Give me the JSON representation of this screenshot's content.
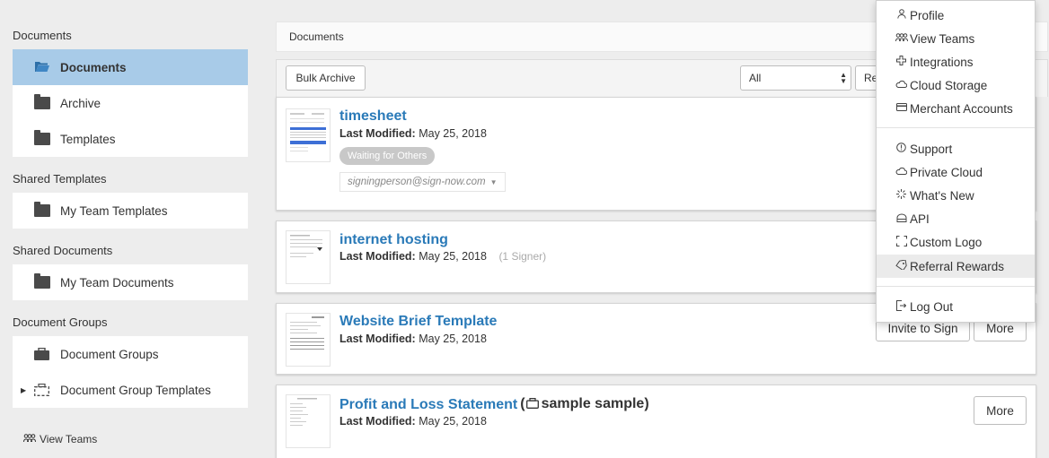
{
  "sidebar": {
    "documents_title": "Documents",
    "documents_items": [
      {
        "label": "Documents",
        "icon": "folder-open-icon",
        "active": true
      },
      {
        "label": "Archive",
        "icon": "folder-icon"
      },
      {
        "label": "Templates",
        "icon": "folder-icon"
      }
    ],
    "shared_templates_title": "Shared Templates",
    "shared_templates_items": [
      {
        "label": "My Team Templates",
        "icon": "folder-icon"
      }
    ],
    "shared_documents_title": "Shared Documents",
    "shared_documents_items": [
      {
        "label": "My Team Documents",
        "icon": "folder-icon"
      }
    ],
    "document_groups_title": "Document Groups",
    "document_groups_items": [
      {
        "label": "Document Groups",
        "icon": "briefcase-icon"
      },
      {
        "label": "Document Group Templates",
        "icon": "dashed-briefcase-icon"
      }
    ],
    "view_teams": "View Teams"
  },
  "breadcrumb": "Documents",
  "toolbar": {
    "bulk_archive": "Bulk Archive",
    "filter_selected": "All",
    "sort_partial": "Re"
  },
  "documents": [
    {
      "title": "timesheet",
      "modified_label": "Last Modified:",
      "modified_value": "May 25, 2018",
      "status": "Waiting for Others",
      "email": "signingperson@sign-now.com"
    },
    {
      "title": "internet hosting",
      "modified_label": "Last Modified:",
      "modified_value": "May 25, 2018",
      "signer_count": "(1 Signer)"
    },
    {
      "title": "Website Brief Template",
      "modified_label": "Last Modified:",
      "modified_value": "May 25, 2018",
      "invite_label": "Invite to Sign",
      "more_label": "More"
    },
    {
      "title": "Profit and Loss Statement",
      "folder_label": "sample sample",
      "modified_label": "Last Modified:",
      "modified_value": "May 25, 2018",
      "more_label": "More"
    }
  ],
  "menu": {
    "items": [
      {
        "label": "Profile",
        "icon": "user-icon"
      },
      {
        "label": "View Teams",
        "icon": "team-icon"
      },
      {
        "label": "Integrations",
        "icon": "puzzle-icon"
      },
      {
        "label": "Cloud Storage",
        "icon": "cloud-icon"
      },
      {
        "label": "Merchant Accounts",
        "icon": "credit-card-icon"
      },
      {
        "label": "Support",
        "icon": "info-icon"
      },
      {
        "label": "Private Cloud",
        "icon": "cloud-icon"
      },
      {
        "label": "What's New",
        "icon": "sparkle-icon"
      },
      {
        "label": "API",
        "icon": "api-icon"
      },
      {
        "label": "Custom Logo",
        "icon": "crop-icon"
      },
      {
        "label": "Referral Rewards",
        "icon": "tag-icon",
        "highlighted": true
      },
      {
        "label": "Log Out",
        "icon": "logout-icon"
      }
    ]
  },
  "colors": {
    "link": "#2a7ab8",
    "active_bg": "#a8cbe8",
    "pill_bg": "#c8c8c8"
  }
}
